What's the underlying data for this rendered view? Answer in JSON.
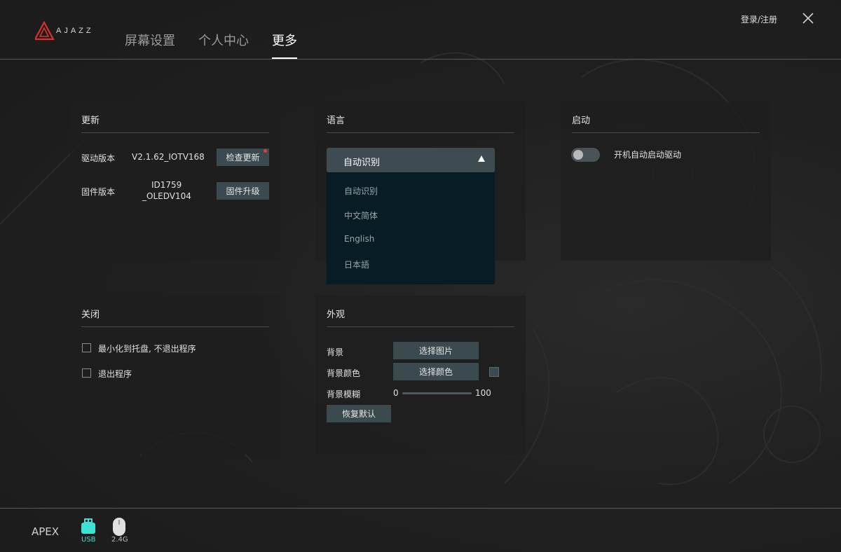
{
  "header": {
    "logo_text": "AJAZZ",
    "tabs": [
      {
        "label": "屏幕设置"
      },
      {
        "label": "个人中心"
      },
      {
        "label": "更多"
      }
    ],
    "active_tab": "更多",
    "login_label": "登录/注册"
  },
  "update_panel": {
    "title": "更新",
    "driver_label": "驱动版本",
    "driver_version": "V2.1.62_IOTV168",
    "check_update_label": "检查更新",
    "firmware_label": "固件版本",
    "firmware_version_line1": "ID1759",
    "firmware_version_line2": "_OLEDV104",
    "firmware_upgrade_label": "固件升级"
  },
  "language_panel": {
    "title": "语言",
    "selected": "自动识别",
    "options": [
      "自动识别",
      "中文简体",
      "English",
      "日本語"
    ]
  },
  "startup_panel": {
    "title": "启动",
    "autostart_label": "开机自动启动驱动",
    "autostart_enabled": false
  },
  "close_panel": {
    "title": "关闭",
    "options": [
      {
        "label": "最小化到托盘, 不退出程序",
        "checked": false
      },
      {
        "label": "退出程序",
        "checked": false
      }
    ]
  },
  "appearance_panel": {
    "title": "外观",
    "background_label": "背景",
    "choose_image_label": "选择图片",
    "bg_color_label": "背景颜色",
    "choose_color_label": "选择颜色",
    "blur_label": "背景模糊",
    "blur_min": "0",
    "blur_max": "100",
    "reset_label": "恢复默认"
  },
  "footer": {
    "device_name": "APEX",
    "usb_label": "USB",
    "wireless_label": "2.4G"
  },
  "colors": {
    "accent": "#3fe0d6",
    "button": "#3b4a4f",
    "dropdown_bg": "#071c25"
  }
}
